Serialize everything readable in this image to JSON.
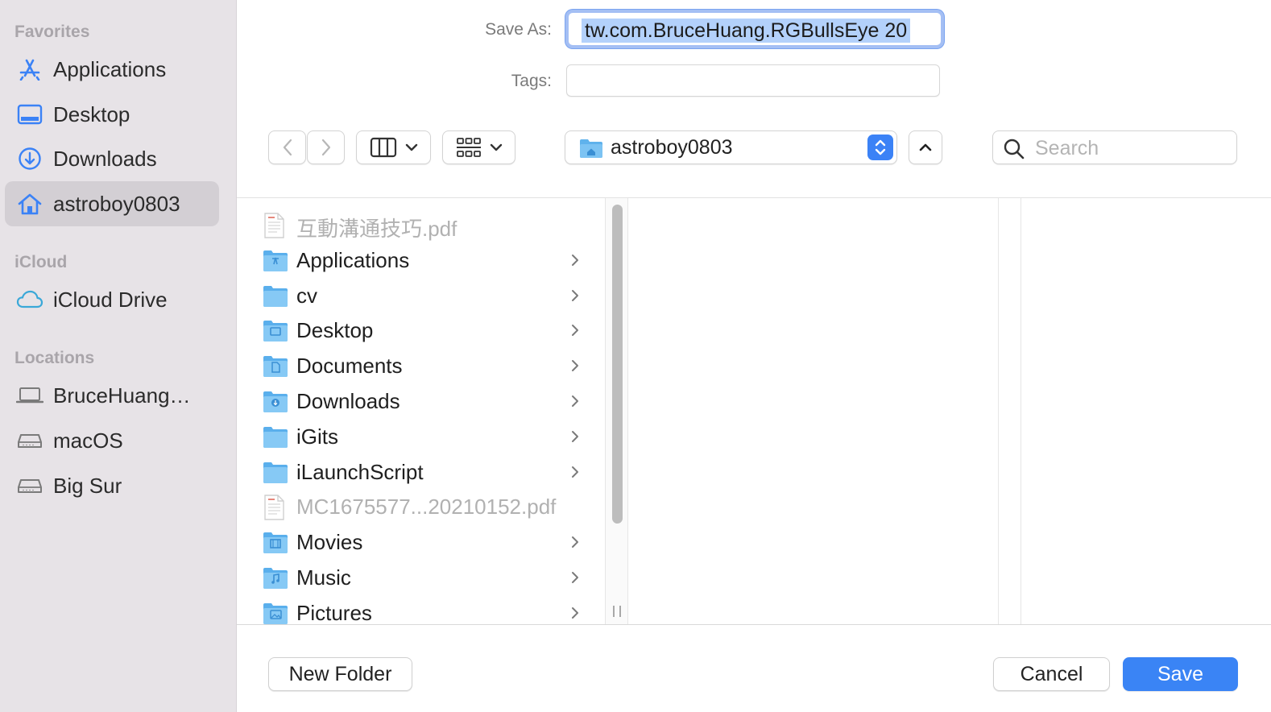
{
  "sidebar": {
    "sections": [
      {
        "title": "Favorites"
      },
      {
        "title": "iCloud"
      },
      {
        "title": "Locations"
      }
    ],
    "items": [
      {
        "label": "Applications",
        "icon": "app-store-icon"
      },
      {
        "label": "Desktop",
        "icon": "desktop-icon"
      },
      {
        "label": "Downloads",
        "icon": "download-icon"
      },
      {
        "label": "astroboy0803",
        "icon": "home-icon",
        "selected": true
      },
      {
        "label": "iCloud Drive",
        "icon": "cloud-icon"
      },
      {
        "label": "BruceHuang…",
        "icon": "laptop-icon"
      },
      {
        "label": "macOS",
        "icon": "disk-icon"
      },
      {
        "label": "Big Sur",
        "icon": "disk-icon"
      }
    ],
    "accent_color": "#3b82f6"
  },
  "form": {
    "save_as_label": "Save As:",
    "save_as_value": "tw.com.BruceHuang.RGBullsEye 20",
    "tags_label": "Tags:",
    "tags_value": ""
  },
  "toolbar": {
    "back_icon": "chevron-left-icon",
    "forward_icon": "chevron-right-icon",
    "view_icon": "columns-view-icon",
    "group_icon": "grid-group-icon",
    "path": "astroboy0803",
    "search_placeholder": "Search"
  },
  "files": [
    {
      "name": "互動溝通技巧.pdf",
      "type": "pdf",
      "enabled": false
    },
    {
      "name": "Applications",
      "type": "folder",
      "badge": "apps",
      "enabled": true
    },
    {
      "name": "cv",
      "type": "folder",
      "badge": "none",
      "enabled": true
    },
    {
      "name": "Desktop",
      "type": "folder",
      "badge": "desktop",
      "enabled": true
    },
    {
      "name": "Documents",
      "type": "folder",
      "badge": "document",
      "enabled": true
    },
    {
      "name": "Downloads",
      "type": "folder",
      "badge": "download",
      "enabled": true
    },
    {
      "name": "iGits",
      "type": "folder",
      "badge": "none",
      "enabled": true
    },
    {
      "name": "iLaunchScript",
      "type": "folder",
      "badge": "none",
      "enabled": true
    },
    {
      "name": "MC1675577...20210152.pdf",
      "type": "pdf",
      "enabled": false
    },
    {
      "name": "Movies",
      "type": "folder",
      "badge": "movie",
      "enabled": true
    },
    {
      "name": "Music",
      "type": "folder",
      "badge": "music",
      "enabled": true
    },
    {
      "name": "Pictures",
      "type": "folder",
      "badge": "picture",
      "enabled": true
    }
  ],
  "buttons": {
    "new_folder": "New Folder",
    "cancel": "Cancel",
    "save": "Save"
  }
}
